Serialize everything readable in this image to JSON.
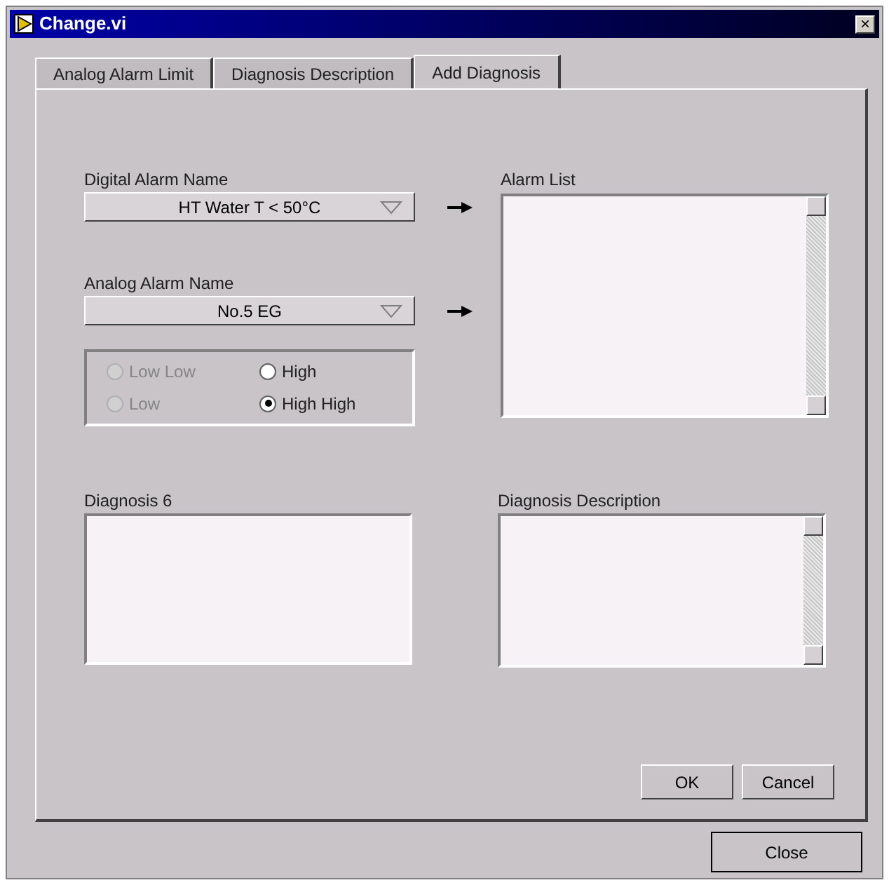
{
  "window": {
    "title": "Change.vi",
    "close": "×"
  },
  "tabs": [
    {
      "label": "Analog Alarm Limit",
      "selected": false
    },
    {
      "label": "Diagnosis Description",
      "selected": false
    },
    {
      "label": "Add Diagnosis",
      "selected": true
    }
  ],
  "digital_alarm": {
    "label": "Digital Alarm Name",
    "value": "HT Water T < 50°C"
  },
  "analog_alarm": {
    "label": "Analog Alarm Name",
    "value": "No.5 EG"
  },
  "levels": [
    {
      "label": "Low Low",
      "selected": false,
      "disabled": true
    },
    {
      "label": "High",
      "selected": false,
      "disabled": false
    },
    {
      "label": "Low",
      "selected": false,
      "disabled": true
    },
    {
      "label": "High High",
      "selected": true,
      "disabled": false
    }
  ],
  "alarm_list": {
    "label": "Alarm List"
  },
  "diagnosis": {
    "label": "Diagnosis 6"
  },
  "diagnosis_description": {
    "label": "Diagnosis Description"
  },
  "buttons": [
    "OK",
    "Cancel"
  ],
  "close_button": "Close"
}
